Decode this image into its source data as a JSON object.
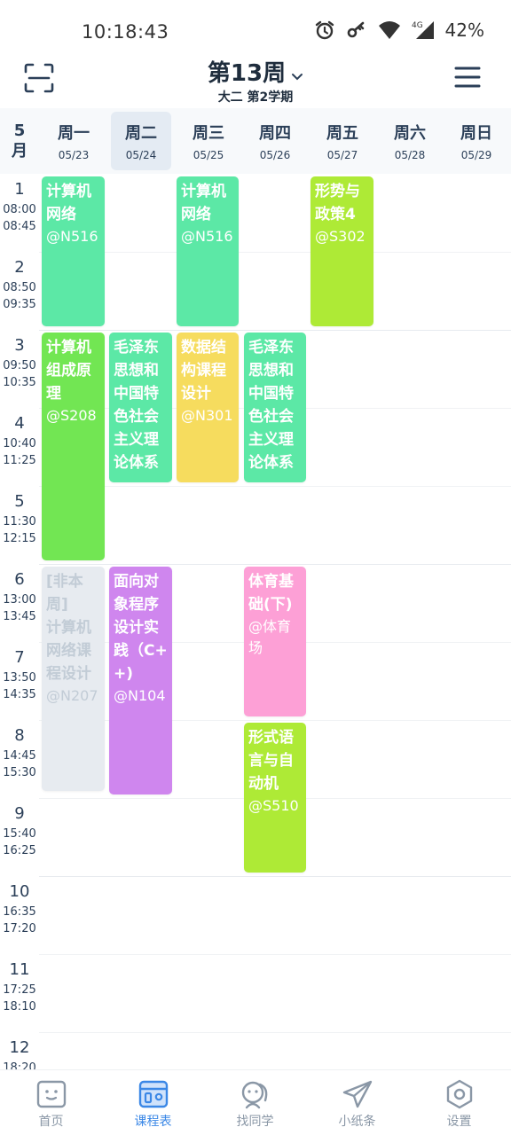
{
  "status_bar": {
    "time": "10:18:43",
    "battery": "42%",
    "network": "4G"
  },
  "header": {
    "week": "第13周",
    "term": "大二 第2学期"
  },
  "month": {
    "num": "5",
    "unit": "月"
  },
  "days": [
    {
      "name": "周一",
      "date": "05/23"
    },
    {
      "name": "周二",
      "date": "05/24"
    },
    {
      "name": "周三",
      "date": "05/25"
    },
    {
      "name": "周四",
      "date": "05/26"
    },
    {
      "name": "周五",
      "date": "05/27"
    },
    {
      "name": "周六",
      "date": "05/28"
    },
    {
      "name": "周日",
      "date": "05/29"
    }
  ],
  "slots": [
    {
      "num": "1",
      "start": "08:00",
      "end": "08:45"
    },
    {
      "num": "2",
      "start": "08:50",
      "end": "09:35"
    },
    {
      "num": "3",
      "start": "09:50",
      "end": "10:35"
    },
    {
      "num": "4",
      "start": "10:40",
      "end": "11:25"
    },
    {
      "num": "5",
      "start": "11:30",
      "end": "12:15"
    },
    {
      "num": "6",
      "start": "13:00",
      "end": "13:45"
    },
    {
      "num": "7",
      "start": "13:50",
      "end": "14:35"
    },
    {
      "num": "8",
      "start": "14:45",
      "end": "15:30"
    },
    {
      "num": "9",
      "start": "15:40",
      "end": "16:25"
    },
    {
      "num": "10",
      "start": "16:35",
      "end": "17:20"
    },
    {
      "num": "11",
      "start": "17:25",
      "end": "18:10"
    },
    {
      "num": "12",
      "start": "18:20",
      "end": ""
    }
  ],
  "courses": [
    {
      "name": "计算机网络",
      "room": "@N516",
      "color": "#5ce8a6"
    },
    {
      "name": "计算机网络",
      "room": "@N516",
      "color": "#5ce8a6"
    },
    {
      "name": "形势与政策4",
      "room": "@S302",
      "color": "#aeea36"
    },
    {
      "name": "计算机组成原理",
      "room": "@S208",
      "color": "#72e653"
    },
    {
      "name": "毛泽东思想和中国特色社会主义理论体系",
      "room": "",
      "color": "#5ce8a6"
    },
    {
      "name": "数据结构课程设计",
      "room": "@N301",
      "color": "#f6dc5e"
    },
    {
      "name": "毛泽东思想和中国特色社会主义理论体系",
      "room": "",
      "color": "#5ce8a6"
    },
    {
      "name": "计算机网络课程设计",
      "room": "@N207",
      "color": "#e7ebf0",
      "flag": "[非本周]"
    },
    {
      "name": "面向对象程序设计实践（C++)",
      "room": "@N104",
      "color": "#cf86ee"
    },
    {
      "name": "体育基础(下)",
      "room": "@体育场",
      "color": "#fda0d6"
    },
    {
      "name": "形式语言与自动机",
      "room": "@S510",
      "color": "#aeea36"
    }
  ],
  "nav": [
    {
      "label": "首页",
      "icon": "home-face-icon"
    },
    {
      "label": "课程表",
      "icon": "schedule-icon"
    },
    {
      "label": "找同学",
      "icon": "classmates-icon"
    },
    {
      "label": "小纸条",
      "icon": "paper-plane-icon"
    },
    {
      "label": "设置",
      "icon": "settings-hexagon-icon"
    }
  ]
}
